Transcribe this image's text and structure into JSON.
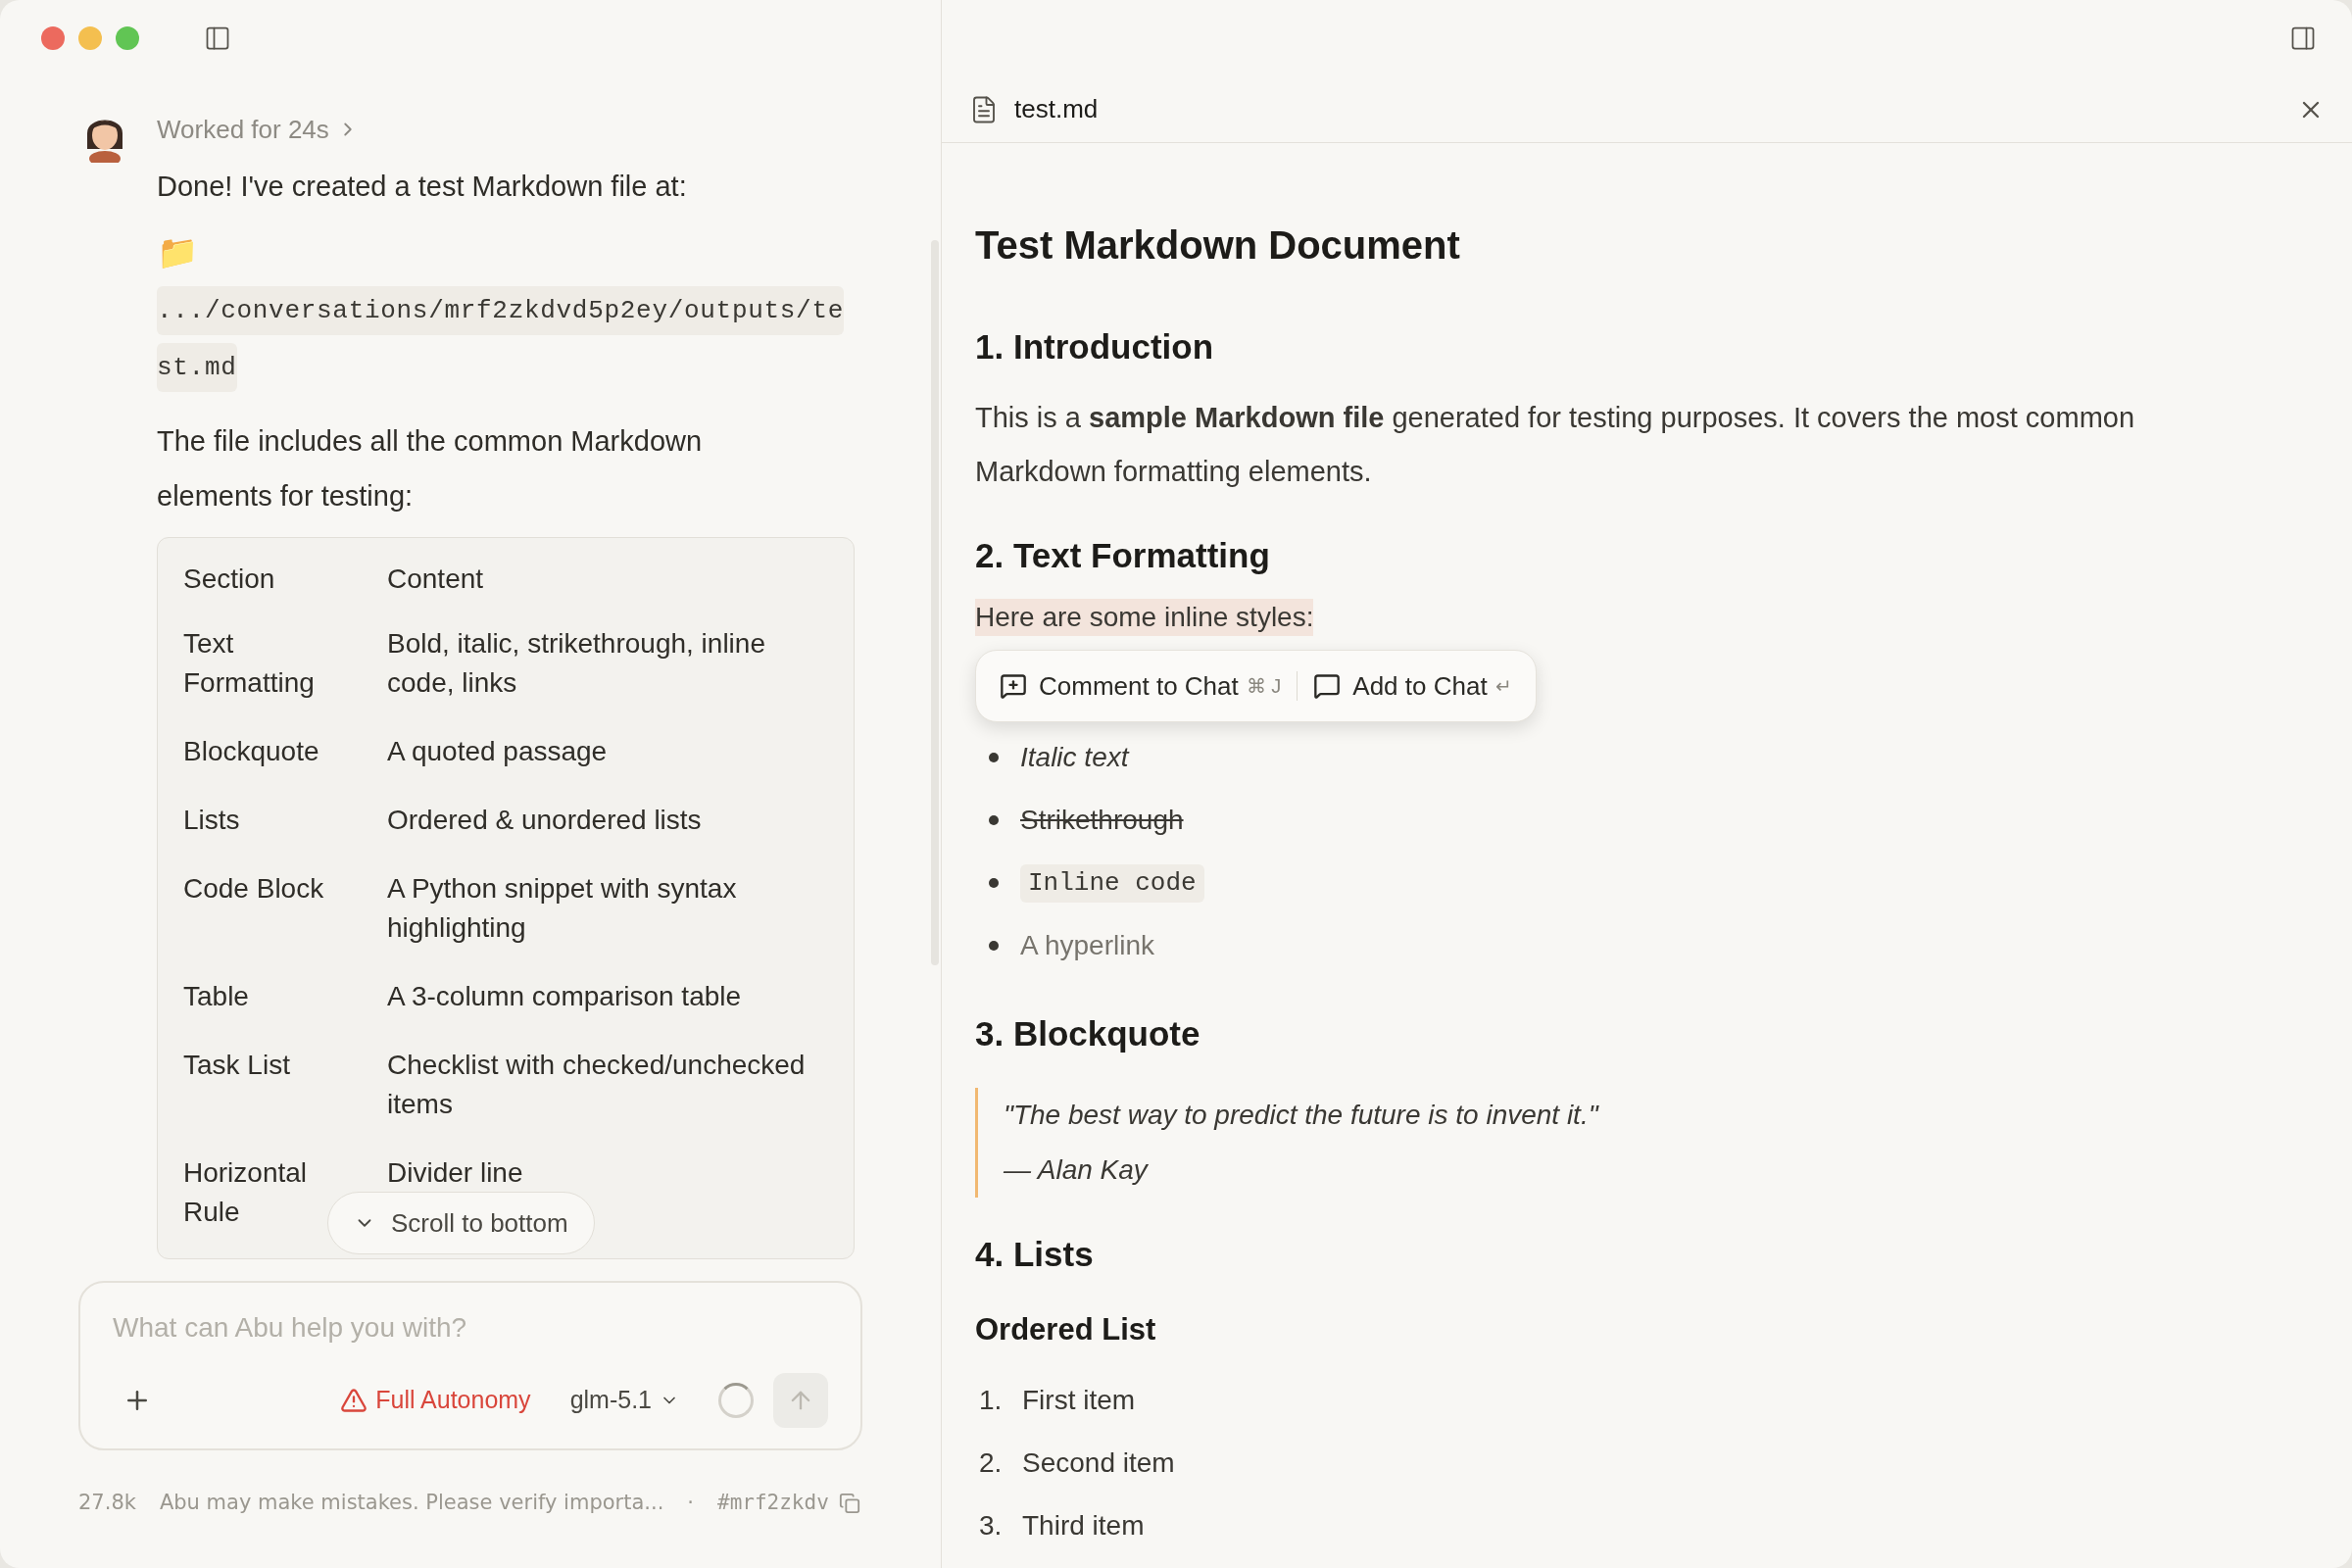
{
  "chat": {
    "worked": "Worked for 24s",
    "message": "Done! I've created a test Markdown file at:",
    "folder_emoji": "📁",
    "path": ".../conversations/mrf2zkdvd5p2ey/outputs/test.md",
    "intro": "The file includes all the common Markdown elements for testing:",
    "table": {
      "columns": [
        "Section",
        "Content"
      ],
      "rows": [
        [
          "Text Formatting",
          "Bold, italic, strikethrough, inline code, links"
        ],
        [
          "Blockquote",
          "A quoted passage"
        ],
        [
          "Lists",
          "Ordered & unordered lists"
        ],
        [
          "Code Block",
          "A Python snippet with syntax highlighting"
        ],
        [
          "Table",
          "A 3-column comparison table"
        ],
        [
          "Task List",
          "Checklist with checked/unchecked items"
        ],
        [
          "Horizontal Rule",
          "Divider line"
        ]
      ]
    },
    "scroll_button": "Scroll to bottom",
    "input": {
      "placeholder": "What can Abu help you with?",
      "autonomy": "Full Autonomy",
      "model": "glm-5.1"
    },
    "footer": {
      "tokens": "27.8k",
      "disclaimer": "Abu may make mistakes. Please verify importa...",
      "separator": "·",
      "id": "#mrf2zkdv"
    }
  },
  "preview": {
    "filename": "test.md",
    "blocks": [
      {
        "kind": "h1",
        "text": "Test Markdown Document"
      },
      {
        "kind": "h2",
        "text": "1. Introduction"
      },
      {
        "kind": "p",
        "text": "This is a **sample Markdown file** generated for testing purposes. It covers the most common Markdown formatting elements."
      },
      {
        "kind": "h2",
        "text": "2. Text Formatting"
      },
      {
        "kind": "highlight",
        "text": "Here are some inline styles:"
      },
      {
        "kind": "bullets",
        "items": [
          {
            "kind": "italic",
            "text": "Italic text"
          },
          {
            "kind": "strike",
            "text": "Strikethrough"
          },
          {
            "kind": "code",
            "text": "Inline code"
          },
          {
            "kind": "link",
            "text": "A hyperlink"
          }
        ]
      },
      {
        "kind": "h2",
        "text": "3. Blockquote"
      },
      {
        "kind": "quote",
        "lines": [
          "\"The best way to predict the future is to invent it.\"",
          "— Alan Kay"
        ]
      },
      {
        "kind": "h2",
        "text": "4. Lists"
      },
      {
        "kind": "h3",
        "text": "Ordered List"
      },
      {
        "kind": "ordered",
        "items": [
          {
            "number": "1.",
            "text": "First item"
          },
          {
            "number": "2.",
            "text": "Second item"
          },
          {
            "number": "3.",
            "text": "Third item"
          }
        ]
      }
    ],
    "popup": {
      "comment": "Comment to Chat",
      "comment_keys": "⌘ J",
      "add": "Add to Chat",
      "add_key": "↵"
    }
  }
}
